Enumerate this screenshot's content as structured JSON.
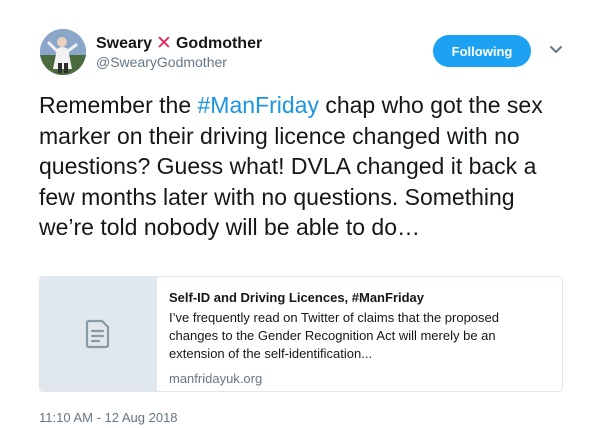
{
  "author": {
    "display_name_first": "Sweary",
    "display_name_mark": "✕",
    "display_name_last": "Godmother",
    "handle": "@SwearyGodmother",
    "avatar_icon": "profile-photo"
  },
  "follow_button": {
    "label": "Following",
    "color": "#1da1f2"
  },
  "menu_caret_icon": "chevron-down-icon",
  "tweet": {
    "text_before_hashtag": "Remember the ",
    "hashtag": "#ManFriday",
    "text_after_hashtag": " chap who got the sex marker on their driving licence changed with no questions? Guess what! DVLA changed it back a few months later with no questions. Something we’re told nobody will be able to do…",
    "hashtag_color": "#1b95e0"
  },
  "link_card": {
    "thumbnail_icon": "document-icon",
    "title": "Self-ID and Driving Licences, #ManFriday",
    "description": "I’ve frequently read on Twitter of claims that the proposed changes to the Gender Recognition Act will merely be an extension of the self-identification...",
    "domain": "manfridayuk.org"
  },
  "timestamp": "11:10 AM - 12 Aug 2018",
  "colors": {
    "text": "#14171a",
    "muted": "#657786",
    "border": "#e1e8ed",
    "accent_red": "#e0245e"
  }
}
